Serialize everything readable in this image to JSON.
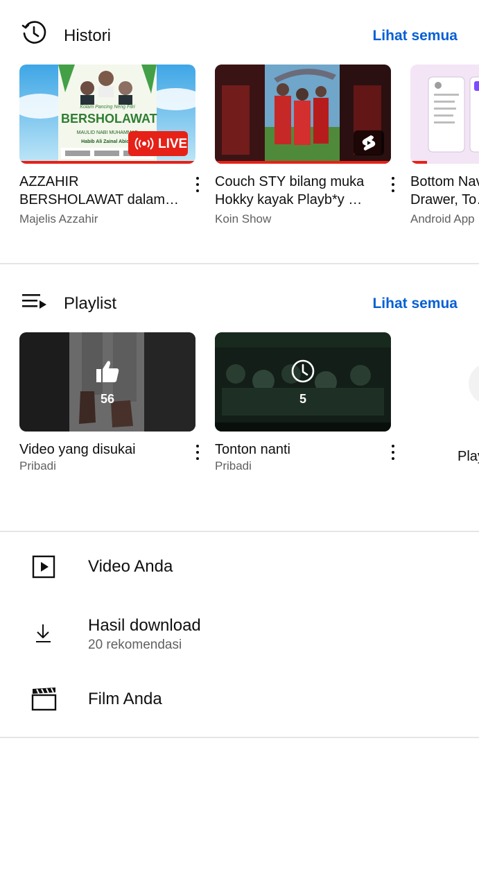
{
  "history": {
    "title": "Histori",
    "see_all": "Lihat semua",
    "icon": "history-icon",
    "items": [
      {
        "title": "AZZAHIR BERSHOLAWAT dalam…",
        "channel": "Majelis Azzahir",
        "badge": "LIVE",
        "thumb_text_1": "Kolam Pancing Neng Fitri",
        "thumb_text_2": "BERSHOLAWAT",
        "thumb_text_3": "MAULID NABI MUHAMMAD",
        "thumb_text_4": "Habib Ali Zainal Abidin"
      },
      {
        "title": "Couch STY bilang muka Hokky kayak Playb*y …",
        "channel": "Koin Show"
      },
      {
        "title": "Bottom Navigation Drawer, To…",
        "channel": "Android App"
      }
    ]
  },
  "playlist": {
    "title": "Playlist",
    "see_all": "Lihat semua",
    "icon": "playlist-icon",
    "items": [
      {
        "title": "Video yang disukai",
        "owner": "Pribadi",
        "count": "56",
        "icon": "thumbs-up-icon"
      },
      {
        "title": "Tonton nanti",
        "owner": "Pribadi",
        "count": "5",
        "icon": "clock-icon"
      },
      {
        "title": "Playlist baru"
      }
    ]
  },
  "menu": [
    {
      "label": "Video Anda",
      "icon": "video-play-icon"
    },
    {
      "label": "Hasil download",
      "sublabel": "20 rekomendasi",
      "icon": "download-icon"
    },
    {
      "label": "Film Anda",
      "icon": "clapperboard-icon"
    }
  ],
  "colors": {
    "accent": "#065fd4",
    "live_red": "#e62117",
    "text_primary": "#0f0f0f",
    "text_secondary": "#606060",
    "divider": "#e5e5e5"
  }
}
